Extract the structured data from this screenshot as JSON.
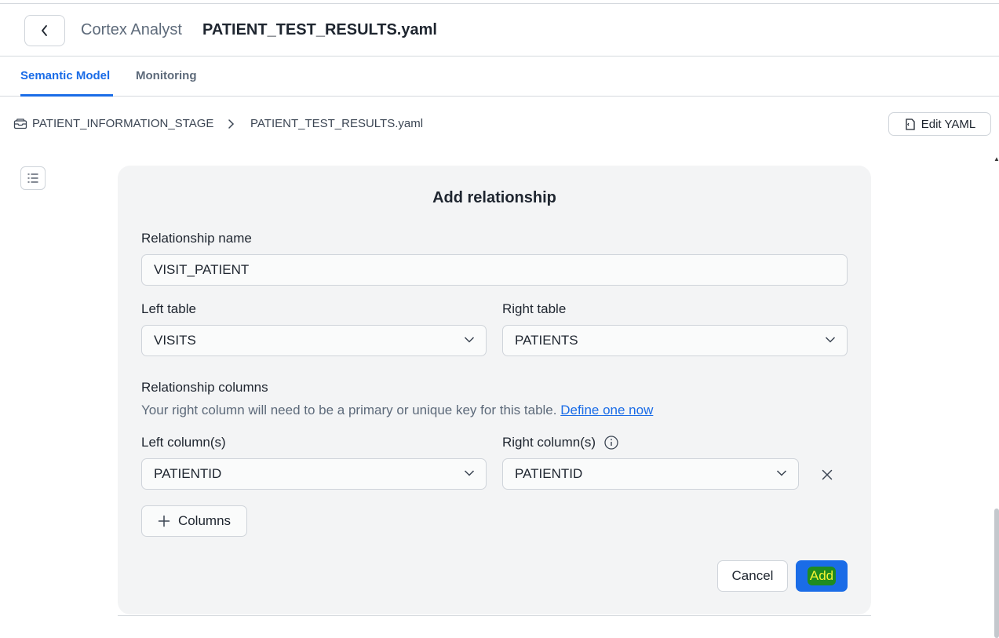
{
  "header": {
    "app_name": "Cortex Analyst",
    "file_name": "PATIENT_TEST_RESULTS.yaml"
  },
  "tabs": [
    {
      "label": "Semantic Model",
      "active": true
    },
    {
      "label": "Monitoring",
      "active": false
    }
  ],
  "breadcrumb": {
    "stage": "PATIENT_INFORMATION_STAGE",
    "file": "PATIENT_TEST_RESULTS.yaml"
  },
  "toolbar": {
    "edit_yaml_label": "Edit YAML"
  },
  "dialog": {
    "title": "Add relationship",
    "relationship_name_label": "Relationship name",
    "relationship_name_value": "VISIT_PATIENT",
    "left_table_label": "Left table",
    "left_table_value": "VISITS",
    "right_table_label": "Right table",
    "right_table_value": "PATIENTS",
    "relationship_columns_label": "Relationship columns",
    "helper_text": "Your right column will need to be a primary or unique key for this table.",
    "helper_link": "Define one now",
    "left_columns_label": "Left column(s)",
    "left_column_value": "PATIENTID",
    "right_columns_label": "Right column(s)",
    "right_column_value": "PATIENTID",
    "add_columns_label": "Columns",
    "cancel_label": "Cancel",
    "add_label": "Add"
  },
  "colors": {
    "accent": "#1a6ce7",
    "add_highlight_bg": "#1f8c1f",
    "add_highlight_text": "#f6f433"
  }
}
